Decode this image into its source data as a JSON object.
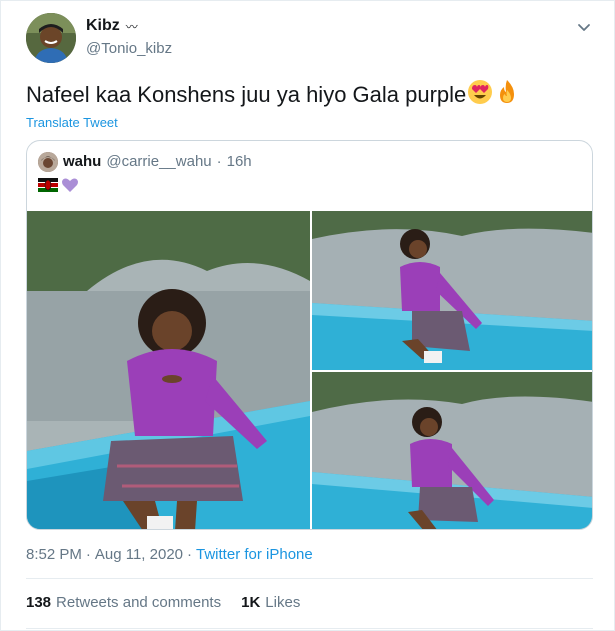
{
  "author": {
    "display_name": "Kibz",
    "name_mark": "〰",
    "handle": "@Tonio_kibz"
  },
  "tweet": {
    "text": "Nafeel kaa Konshens juu ya hiyo Gala purple",
    "emojis": [
      "heart-eyes-emoji",
      "fire-emoji"
    ],
    "translate_label": "Translate Tweet"
  },
  "quote": {
    "display_name": "wahu",
    "handle": "@carrie__wahu",
    "separator": "·",
    "time": "16h",
    "emojis": [
      "kenya-flag-emoji",
      "purple-heart-emoji"
    ]
  },
  "meta": {
    "time": "8:52 PM",
    "separator": "·",
    "date": "Aug 11, 2020",
    "separator2": "·",
    "source": "Twitter for iPhone"
  },
  "stats": {
    "retweets_count": "138",
    "retweets_label": "Retweets and comments",
    "likes_count": "1K",
    "likes_label": "Likes"
  },
  "colors": {
    "link": "#1b95e0",
    "secondary_text": "#657786",
    "border": "#e6ecf0",
    "boat": "#2aa7cf",
    "outfit_purple": "#9b3fb8",
    "lake": "#9aa7ad",
    "forest": "#3f5a3a"
  }
}
